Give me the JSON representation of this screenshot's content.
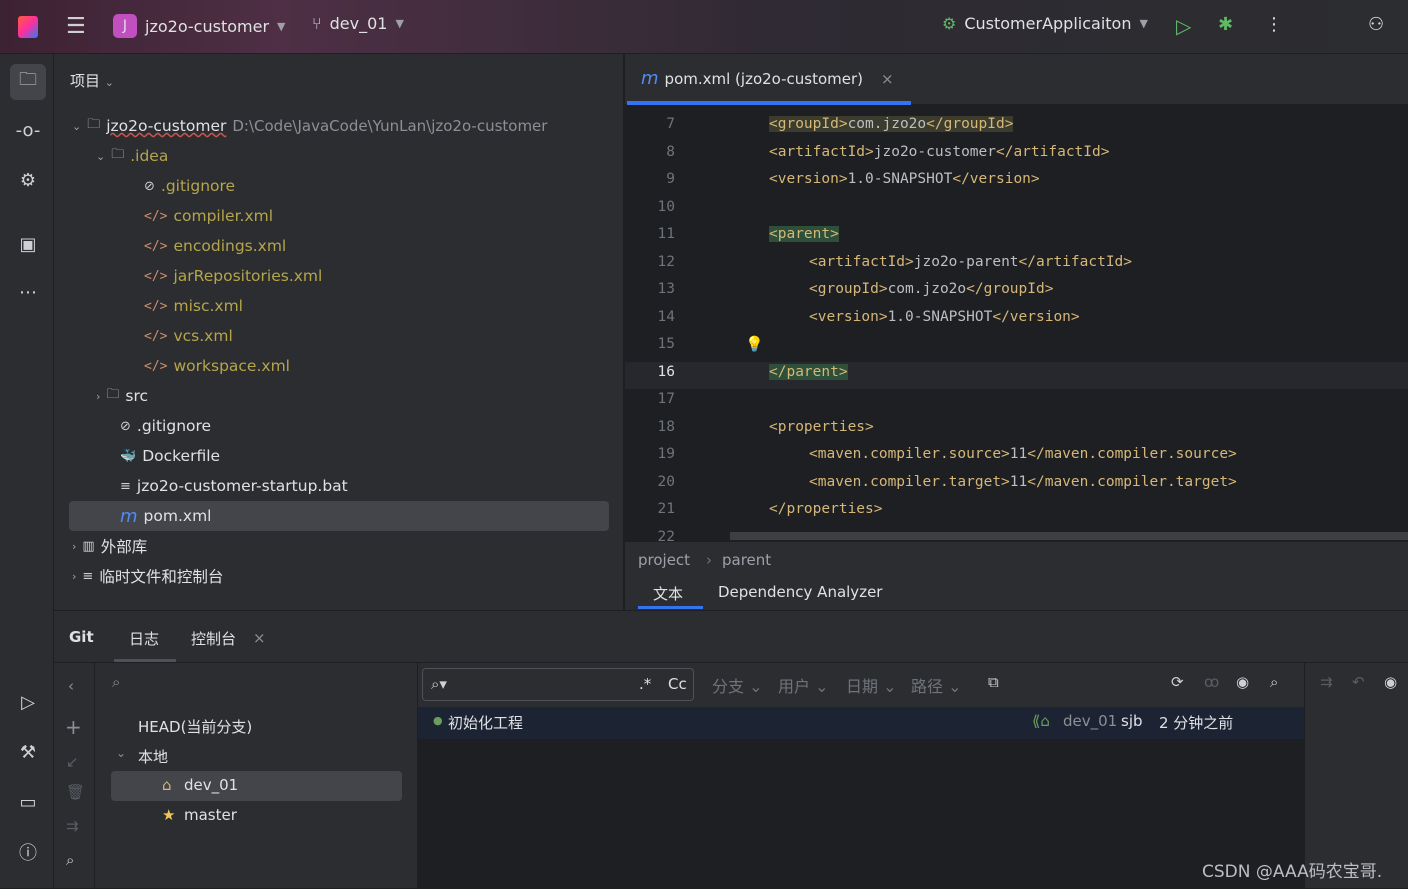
{
  "titlebar": {
    "app_initial": "J",
    "project": "jzo2o-customer",
    "branch": "dev_01",
    "run_config": "CustomerApplicaiton"
  },
  "project_panel": {
    "title": "项目",
    "root": {
      "name": "jzo2o-customer",
      "path": "D:\\Code\\JavaCode\\YunLan\\jzo2o-customer"
    },
    "items": [
      {
        "name": ".idea",
        "type": "folder"
      },
      {
        "name": ".gitignore",
        "type": "ignore"
      },
      {
        "name": "compiler.xml",
        "type": "xml"
      },
      {
        "name": "encodings.xml",
        "type": "xml"
      },
      {
        "name": "jarRepositories.xml",
        "type": "xml"
      },
      {
        "name": "misc.xml",
        "type": "xml"
      },
      {
        "name": "vcs.xml",
        "type": "xml"
      },
      {
        "name": "workspace.xml",
        "type": "xml"
      },
      {
        "name": "src",
        "type": "folder"
      },
      {
        "name": ".gitignore",
        "type": "ignore"
      },
      {
        "name": "Dockerfile",
        "type": "docker"
      },
      {
        "name": "jzo2o-customer-startup.bat",
        "type": "bat"
      },
      {
        "name": "pom.xml",
        "type": "maven"
      },
      {
        "name": "外部库",
        "type": "lib"
      },
      {
        "name": "临时文件和控制台",
        "type": "scratch"
      }
    ]
  },
  "editor": {
    "tab": "pom.xml (jzo2o-customer)",
    "current_line": 16,
    "lines": [
      {
        "n": "7",
        "code": "<groupId>com.jzo2o</groupId>",
        "indent": 0
      },
      {
        "n": "8",
        "code": "<artifactId>jzo2o-customer</artifactId>",
        "indent": 0
      },
      {
        "n": "9",
        "code": "<version>1.0-SNAPSHOT</version>",
        "indent": 0
      },
      {
        "n": "10",
        "code": "",
        "indent": 0
      },
      {
        "n": "11",
        "code": "<parent>",
        "indent": 0
      },
      {
        "n": "12",
        "code": "<artifactId>jzo2o-parent</artifactId>",
        "indent": 1
      },
      {
        "n": "13",
        "code": "<groupId>com.jzo2o</groupId>",
        "indent": 1
      },
      {
        "n": "14",
        "code": "<version>1.0-SNAPSHOT</version>",
        "indent": 1
      },
      {
        "n": "15",
        "code": "",
        "indent": 0
      },
      {
        "n": "16",
        "code": "</parent>",
        "indent": 0
      },
      {
        "n": "17",
        "code": "",
        "indent": 0
      },
      {
        "n": "18",
        "code": "<properties>",
        "indent": 0
      },
      {
        "n": "19",
        "code": "<maven.compiler.source>11</maven.compiler.source>",
        "indent": 1
      },
      {
        "n": "20",
        "code": "<maven.compiler.target>11</maven.compiler.target>",
        "indent": 1
      },
      {
        "n": "21",
        "code": "</properties>",
        "indent": 0
      },
      {
        "n": "22",
        "code": "",
        "indent": 0
      }
    ],
    "breadcrumb": [
      "project",
      "parent"
    ],
    "bottom_tabs": [
      "文本",
      "Dependency Analyzer"
    ]
  },
  "git": {
    "tabs": [
      "Git",
      "日志",
      "控制台"
    ],
    "branches": {
      "head": "HEAD(当前分支)",
      "local": "本地",
      "items": [
        "dev_01",
        "master"
      ]
    },
    "filters": [
      "分支",
      "用户",
      "日期",
      "路径"
    ],
    "regex": ".*",
    "case": "Cc",
    "commits": [
      {
        "message": "初始化工程",
        "branch": "dev_01",
        "author": "sjb",
        "time": "2 分钟之前"
      }
    ]
  },
  "watermark": "CSDN @AAA码农宝哥."
}
